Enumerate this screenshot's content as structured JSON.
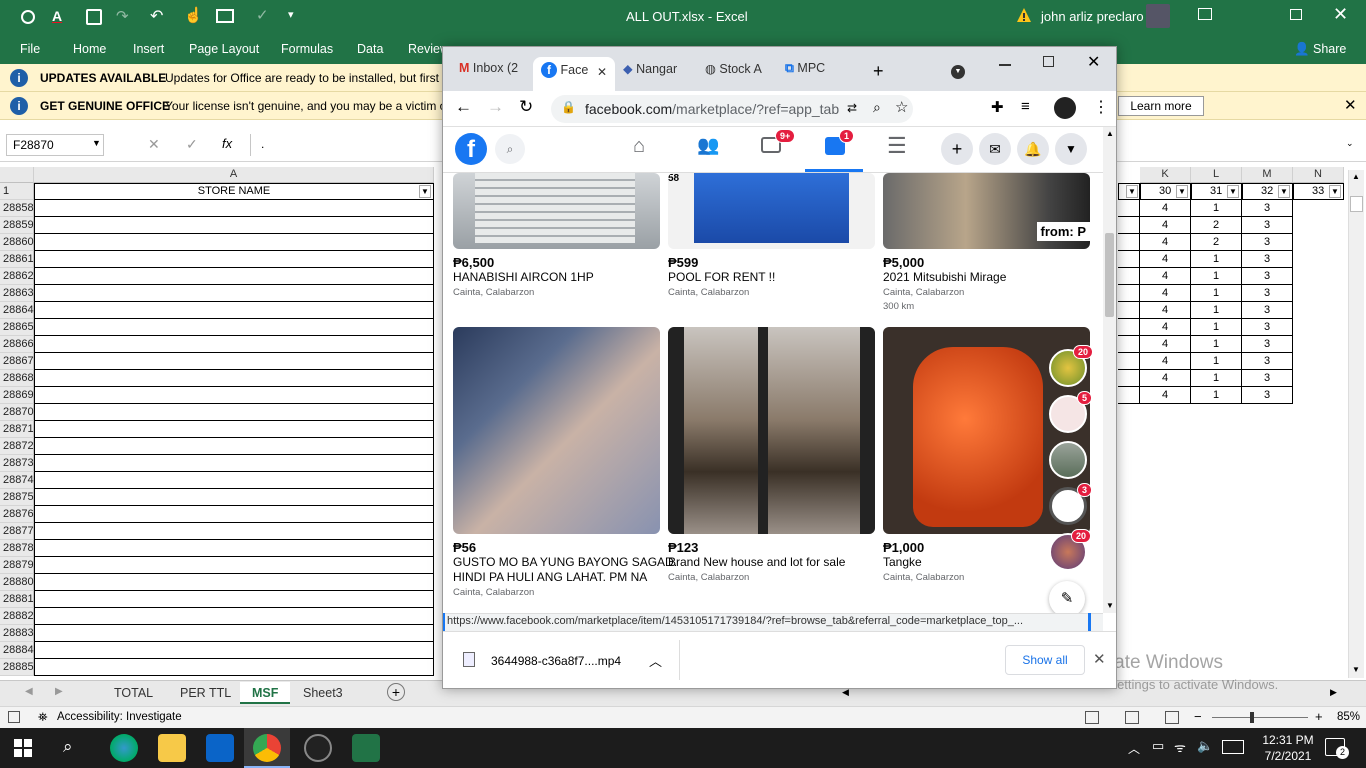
{
  "excel": {
    "title": "ALL OUT.xlsx  -  Excel",
    "warning_icon": "warning-icon",
    "user_name": "john arliz preclaro",
    "ribbon_tabs": [
      "File",
      "Home",
      "Insert",
      "Page Layout",
      "Formulas",
      "Data",
      "Review"
    ],
    "share_label": "Share",
    "messages": [
      {
        "title": "UPDATES AVAILABLE",
        "text": "Updates for Office are ready to be installed, but first w"
      },
      {
        "title": "GET GENUINE OFFICE",
        "text": "Your license isn't genuine, and you may be a victim o"
      }
    ],
    "learn_more": "Learn more",
    "name_box": "F28870",
    "fx": "fx",
    "formula_value": ".",
    "col_a": "A",
    "col_a_header": "STORE NAME",
    "header_row_num": "1",
    "right_cols": [
      {
        "letter": "K",
        "val": "30"
      },
      {
        "letter": "L",
        "val": "31"
      },
      {
        "letter": "M",
        "val": "32"
      },
      {
        "letter": "N",
        "val": "33"
      }
    ],
    "rows": [
      "28858",
      "28859",
      "28860",
      "28861",
      "28862",
      "28863",
      "28864",
      "28865",
      "28866",
      "28867",
      "28868",
      "28869",
      "28870",
      "28871",
      "28872",
      "28873",
      "28874",
      "28875",
      "28876",
      "28877",
      "28878",
      "28879",
      "28880",
      "28881",
      "28882",
      "28883",
      "28884",
      "28885"
    ],
    "data_cells": [
      [
        "4",
        "1",
        "3"
      ],
      [
        "4",
        "2",
        "3"
      ],
      [
        "4",
        "2",
        "3"
      ],
      [
        "4",
        "1",
        "3"
      ],
      [
        "4",
        "1",
        "3"
      ],
      [
        "4",
        "1",
        "3"
      ],
      [
        "4",
        "1",
        "3"
      ],
      [
        "4",
        "1",
        "3"
      ],
      [
        "4",
        "1",
        "3"
      ],
      [
        "4",
        "1",
        "3"
      ],
      [
        "4",
        "1",
        "3"
      ],
      [
        "4",
        "1",
        "3"
      ]
    ],
    "sheet_tabs": [
      "TOTAL",
      "PER TTL",
      "MSF",
      "Sheet3"
    ],
    "active_sheet": "MSF",
    "accessibility": "Accessibility: Investigate",
    "zoom": "85%",
    "activate_title": "Activate Windows",
    "activate_sub": "Go to Settings to activate Windows."
  },
  "chrome": {
    "tabs": [
      {
        "label": "Inbox (2",
        "icon": "gmail-icon"
      },
      {
        "label": "Face",
        "icon": "facebook-icon"
      },
      {
        "label": "Nangar",
        "icon": "shield-icon"
      },
      {
        "label": "Stock A",
        "icon": "globe-icon"
      },
      {
        "label": "MPC",
        "icon": "mpc-icon"
      }
    ],
    "url_host": "facebook.com",
    "url_path": "/marketplace/?ref=app_tab",
    "status_url": "https://www.facebook.com/marketplace/item/1453105171739184/?ref=browse_tab&referral_code=marketplace_top_...",
    "download_file": "3644988-c36a8f7....mp4",
    "show_all": "Show all"
  },
  "facebook": {
    "video_badge": "9+",
    "market_badge": "1",
    "listings": [
      {
        "price": "₱6,500",
        "title": "HANABISHI AIRCON 1HP",
        "location": "Cainta, Calabarzon",
        "extra": ""
      },
      {
        "price": "₱599",
        "title": "POOL FOR RENT !!",
        "location": "Cainta, Calabarzon",
        "extra": ""
      },
      {
        "price": "₱5,000",
        "title": "2021 Mitsubishi Mirage",
        "location": "Cainta, Calabarzon",
        "extra": "300 km"
      },
      {
        "price": "₱56",
        "title": "GUSTO MO BA YUNG BAYONG SAGAD.",
        "title2": "HINDI PA HULI ANG LAHAT. PM NA",
        "location": "Cainta, Calabarzon",
        "extra": ""
      },
      {
        "price": "₱123",
        "title": "Brand New house and lot for sale",
        "location": "Cainta, Calabarzon",
        "extra": ""
      },
      {
        "price": "₱1,000",
        "title": "Tangke",
        "location": "Cainta, Calabarzon",
        "extra": ""
      }
    ],
    "image_text_from": "from: P",
    "chat_heads": [
      {
        "badge": "20"
      },
      {
        "badge": "5"
      },
      {
        "badge": ""
      },
      {
        "badge": "3"
      },
      {
        "badge": "20"
      }
    ],
    "price_fragment": "58"
  },
  "taskbar": {
    "time": "12:31 PM",
    "date": "7/2/2021",
    "notif": "2"
  }
}
